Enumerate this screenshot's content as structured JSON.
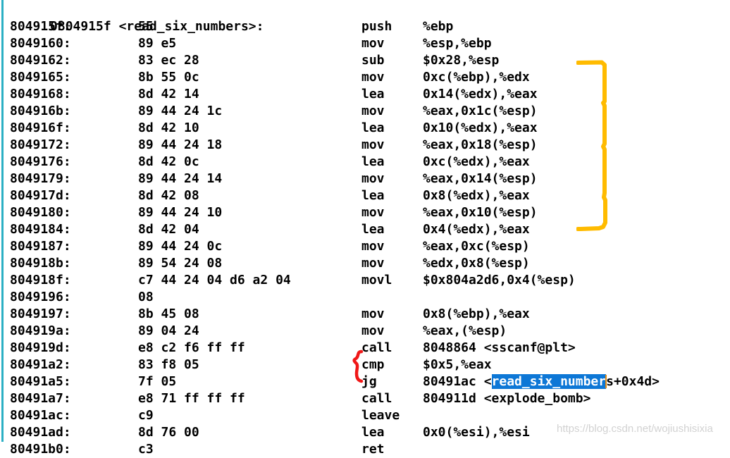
{
  "colors": {
    "background": "#ffffff",
    "text": "#000000",
    "selection_background": "#0d77d6",
    "selection_text": "#ffffff",
    "caret": "#e08a14",
    "annotation_orange": "#ffbb00",
    "annotation_red": "#f01818",
    "gutter_line": "#2bafc4",
    "watermark": "#d2d2d2"
  },
  "header": {
    "text": "0804915f <read_six_numbers>:"
  },
  "watermark": {
    "text": "https://blog.csdn.net/wojiushisixia"
  },
  "annotations": [
    {
      "name": "orange-bracket",
      "shape": "bracket",
      "color": "#ffbb00",
      "marks": "lines 8049162 through 8049184 (argument setup block)"
    },
    {
      "name": "red-brace",
      "shape": "brace",
      "color": "#f01818",
      "marks": "cmp $0x5,%eax and jg 80491ac"
    }
  ],
  "selection": {
    "highlighted_text": "read_six_number",
    "trailing_text": "s+0x4d>",
    "leading_text": "<"
  },
  "listing": [
    {
      "addr": "804915f:",
      "bytes": "55",
      "mnem": "push",
      "ops": "%ebp"
    },
    {
      "addr": "8049160:",
      "bytes": "89 e5",
      "mnem": "mov",
      "ops": "%esp,%ebp"
    },
    {
      "addr": "8049162:",
      "bytes": "83 ec 28",
      "mnem": "sub",
      "ops": "$0x28,%esp"
    },
    {
      "addr": "8049165:",
      "bytes": "8b 55 0c",
      "mnem": "mov",
      "ops": "0xc(%ebp),%edx"
    },
    {
      "addr": "8049168:",
      "bytes": "8d 42 14",
      "mnem": "lea",
      "ops": "0x14(%edx),%eax"
    },
    {
      "addr": "804916b:",
      "bytes": "89 44 24 1c",
      "mnem": "mov",
      "ops": "%eax,0x1c(%esp)"
    },
    {
      "addr": "804916f:",
      "bytes": "8d 42 10",
      "mnem": "lea",
      "ops": "0x10(%edx),%eax"
    },
    {
      "addr": "8049172:",
      "bytes": "89 44 24 18",
      "mnem": "mov",
      "ops": "%eax,0x18(%esp)"
    },
    {
      "addr": "8049176:",
      "bytes": "8d 42 0c",
      "mnem": "lea",
      "ops": "0xc(%edx),%eax"
    },
    {
      "addr": "8049179:",
      "bytes": "89 44 24 14",
      "mnem": "mov",
      "ops": "%eax,0x14(%esp)"
    },
    {
      "addr": "804917d:",
      "bytes": "8d 42 08",
      "mnem": "lea",
      "ops": "0x8(%edx),%eax"
    },
    {
      "addr": "8049180:",
      "bytes": "89 44 24 10",
      "mnem": "mov",
      "ops": "%eax,0x10(%esp)"
    },
    {
      "addr": "8049184:",
      "bytes": "8d 42 04",
      "mnem": "lea",
      "ops": "0x4(%edx),%eax"
    },
    {
      "addr": "8049187:",
      "bytes": "89 44 24 0c",
      "mnem": "mov",
      "ops": "%eax,0xc(%esp)"
    },
    {
      "addr": "804918b:",
      "bytes": "89 54 24 08",
      "mnem": "mov",
      "ops": "%edx,0x8(%esp)"
    },
    {
      "addr": "804918f:",
      "bytes": "c7 44 24 04 d6 a2 04",
      "mnem": "movl",
      "ops": "$0x804a2d6,0x4(%esp)"
    },
    {
      "addr": "8049196:",
      "bytes": "08",
      "mnem": "",
      "ops": ""
    },
    {
      "addr": "8049197:",
      "bytes": "8b 45 08",
      "mnem": "mov",
      "ops": "0x8(%ebp),%eax"
    },
    {
      "addr": "804919a:",
      "bytes": "89 04 24",
      "mnem": "mov",
      "ops": "%eax,(%esp)"
    },
    {
      "addr": "804919d:",
      "bytes": "e8 c2 f6 ff ff",
      "mnem": "call",
      "ops": "8048864 <sscanf@plt>"
    },
    {
      "addr": "80491a2:",
      "bytes": "83 f8 05",
      "mnem": "cmp",
      "ops": "$0x5,%eax"
    },
    {
      "addr": "80491a5:",
      "bytes": "7f 05",
      "mnem": "jg",
      "ops": "80491ac <read_six_numbers+0x4d>",
      "selected": true
    },
    {
      "addr": "80491a7:",
      "bytes": "e8 71 ff ff ff",
      "mnem": "call",
      "ops": "804911d <explode_bomb>"
    },
    {
      "addr": "80491ac:",
      "bytes": "c9",
      "mnem": "leave",
      "ops": ""
    },
    {
      "addr": "80491ad:",
      "bytes": "8d 76 00",
      "mnem": "lea",
      "ops": "0x0(%esi),%esi"
    },
    {
      "addr": "80491b0:",
      "bytes": "c3",
      "mnem": "ret",
      "ops": ""
    }
  ]
}
